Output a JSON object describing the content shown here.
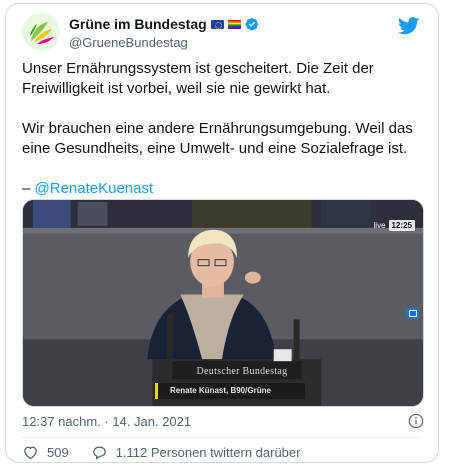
{
  "header": {
    "display_name": "Grüne im Bundestag",
    "handle": "@GrueneBundestag",
    "icons": [
      "avatar-sunflower",
      "eu-flag-icon",
      "rainbow-flag-icon",
      "verified-badge-icon",
      "twitter-bird-icon"
    ]
  },
  "tweet": {
    "paragraph1": "Unser Ernährungssystem ist gescheitert. Die Zeit der\nFreiwilligkeit ist vorbei, weil sie nie gewirkt hat.",
    "paragraph2": "Wir brauchen eine andere Ernährungsumgebung. Weil das\neine Gesundheits, eine Umwelt- und eine Sozialefrage ist.",
    "attribution_prefix": "– ",
    "mention": "@RenateKuenast"
  },
  "media": {
    "live_label": "live",
    "live_time": "12:25",
    "lectern_text": "Deutscher Bundestag",
    "caption": "Renate Künast, B90/Grüne"
  },
  "footer": {
    "timestamp": "12:37 nachm. · 14. Jan. 2021",
    "likes": "509",
    "discussion": "1.112 Personen twittern darüber"
  },
  "colors": {
    "accent": "#1d9bf0",
    "text": "#0f1419",
    "muted": "#536471",
    "border": "#cfd9de"
  }
}
